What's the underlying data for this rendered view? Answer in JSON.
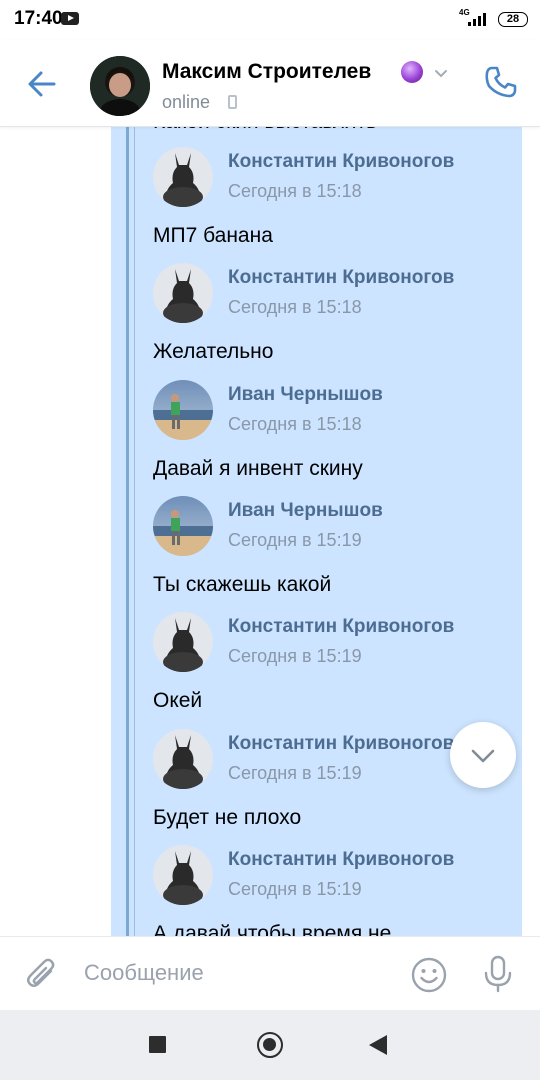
{
  "status_bar": {
    "time": "17:40",
    "network": "4G",
    "battery": "28"
  },
  "header": {
    "name": "Максим Строителев",
    "status": "online"
  },
  "feed": {
    "partial_top_text": "Какой скин выставлять",
    "messages": [
      {
        "author": "Константин Кривоногов",
        "time": "Сегодня в 15:18",
        "text": "МП7 банана",
        "avatar": "konstantin"
      },
      {
        "author": "Константин Кривоногов",
        "time": "Сегодня в 15:18",
        "text": "Желательно",
        "avatar": "konstantin"
      },
      {
        "author": "Иван Чернышов",
        "time": "Сегодня в 15:18",
        "text": "Давай я инвент скину",
        "avatar": "ivan"
      },
      {
        "author": "Иван Чернышов",
        "time": "Сегодня в 15:19",
        "text": "Ты скажешь какой",
        "avatar": "ivan"
      },
      {
        "author": "Константин Кривоногов",
        "time": "Сегодня в 15:19",
        "text": "Окей",
        "avatar": "konstantin"
      },
      {
        "author": "Константин Кривоногов",
        "time": "Сегодня в 15:19",
        "text": "Будет не плохо",
        "avatar": "konstantin"
      },
      {
        "author": "Константин Кривоногов",
        "time": "Сегодня в 15:19",
        "text": "А давай чтобы время не",
        "avatar": "konstantin"
      }
    ]
  },
  "composer": {
    "placeholder": "Сообщение"
  },
  "icons": {
    "back": "arrow-left-icon",
    "call": "phone-icon",
    "attach": "paperclip-icon",
    "emoji": "smile-icon",
    "mic": "microphone-icon",
    "scroll": "chevron-down-icon"
  },
  "colors": {
    "accent": "#4a86c7",
    "bubble": "#cce4ff",
    "author": "#4c6c92",
    "muted": "#818c99"
  }
}
